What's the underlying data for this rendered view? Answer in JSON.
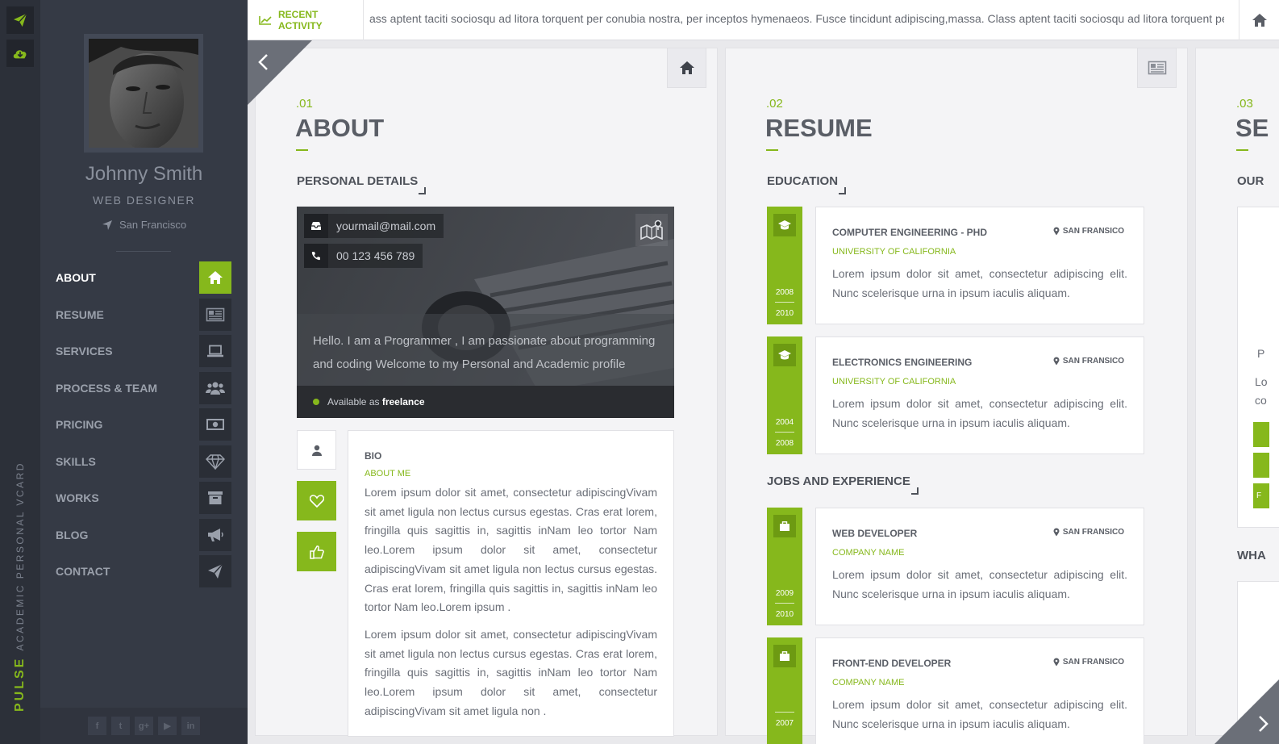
{
  "brand": {
    "word1": "PULSE",
    "word2": "ACADEMIC PERSONAL VCARD",
    "accent": "#86b81c"
  },
  "strip": {
    "buttons": [
      "paper-plane-icon",
      "cloud-download-icon"
    ]
  },
  "profile": {
    "name": "Johnny Smith",
    "role": "WEB DESIGNER",
    "location": "San Francisco"
  },
  "nav": [
    {
      "label": "ABOUT",
      "icon": "home-icon",
      "active": true
    },
    {
      "label": "RESUME",
      "icon": "newspaper-icon"
    },
    {
      "label": "SERVICES",
      "icon": "laptop-icon"
    },
    {
      "label": "PROCESS & TEAM",
      "icon": "users-icon"
    },
    {
      "label": "PRICING",
      "icon": "money-icon"
    },
    {
      "label": "SKILLS",
      "icon": "diamond-icon"
    },
    {
      "label": "WORKS",
      "icon": "archive-icon"
    },
    {
      "label": "BLOG",
      "icon": "bullhorn-icon"
    },
    {
      "label": "CONTACT",
      "icon": "paper-plane-icon"
    }
  ],
  "social": [
    {
      "icon": "facebook-icon",
      "glyph": "f"
    },
    {
      "icon": "twitter-icon",
      "glyph": "t"
    },
    {
      "icon": "google-plus-icon",
      "glyph": "g+"
    },
    {
      "icon": "youtube-icon",
      "glyph": "▶"
    },
    {
      "icon": "linkedin-icon",
      "glyph": "in"
    }
  ],
  "topbar": {
    "label": "RECENT ACTIVITY",
    "ticker": "ass aptent taciti sociosqu ad litora torquent per conubia nostra, per inceptos hymenaeos. Fusce tincidunt adipiscing,massa. Class aptent taciti sociosqu ad litora torquent per conubia nostra"
  },
  "about": {
    "num": ".01",
    "title": "ABOUT",
    "section": "PERSONAL DETAILS",
    "email": "yourmail@mail.com",
    "phone": "00 123 456 789",
    "greeting": "Hello. I am a Programmer , I am passionate about programming and coding Welcome to my Personal and Academic profile",
    "availability_prefix": "Available as",
    "availability": "freelance",
    "bio_title": "BIO",
    "bio_sub": "ABOUT ME",
    "bio_p1": "Lorem ipsum dolor sit amet, consectetur adipiscingVivam sit amet ligula non lectus cursus egestas. Cras erat lorem, fringilla quis sagittis in, sagittis inNam leo tortor Nam leo.Lorem ipsum dolor sit amet, consectetur adipiscingVivam sit amet ligula non lectus cursus egestas. Cras erat lorem, fringilla quis sagittis in, sagittis inNam leo tortor Nam leo.Lorem ipsum .",
    "bio_p2": "Lorem ipsum dolor sit amet, consectetur adipiscingVivam sit amet ligula non lectus cursus egestas. Cras erat lorem, fringilla quis sagittis in, sagittis inNam leo tortor Nam leo.Lorem ipsum dolor sit amet, consectetur adipiscingVivam sit amet ligula non ."
  },
  "resume": {
    "num": ".02",
    "title": "RESUME",
    "education_title": "EDUCATION",
    "education": [
      {
        "title": "COMPUTER ENGINEERING - PHD",
        "location": "SAN FRANSICO",
        "sub": "UNIVERSITY OF CALIFORNIA",
        "text": "Lorem ipsum dolor sit amet, consectetur adipiscing elit. Nunc scelerisque urna in ipsum iaculis aliquam.",
        "from": "2008",
        "to": "2010"
      },
      {
        "title": "ELECTRONICS ENGINEERING",
        "location": "SAN FRANSICO",
        "sub": "UNIVERSITY OF CALIFORNIA",
        "text": "Lorem ipsum dolor sit amet, consectetur adipiscing elit. Nunc scelerisque urna in ipsum iaculis aliquam.",
        "from": "2004",
        "to": "2008"
      }
    ],
    "jobs_title": "JOBS AND EXPERIENCE",
    "jobs": [
      {
        "title": "WEB DEVELOPER",
        "location": "SAN FRANSICO",
        "sub": "COMPANY NAME",
        "text": "Lorem ipsum dolor sit amet, consectetur adipiscing elit. Nunc scelerisque urna in ipsum iaculis aliquam.",
        "from": "2009",
        "to": "2010"
      },
      {
        "title": "FRONT-END DEVELOPER",
        "location": "SAN FRANSICO",
        "sub": "COMPANY NAME",
        "text": "Lorem ipsum dolor sit amet, consectetur adipiscing elit. Nunc scelerisque urna in ipsum iaculis aliquam.",
        "from": "2007"
      }
    ]
  },
  "services": {
    "num": ".03",
    "title": "SE",
    "sub1": "OUR",
    "p": "P",
    "lo1": "Lo",
    "co": "co",
    "f": "F",
    "wha": "WHA"
  }
}
